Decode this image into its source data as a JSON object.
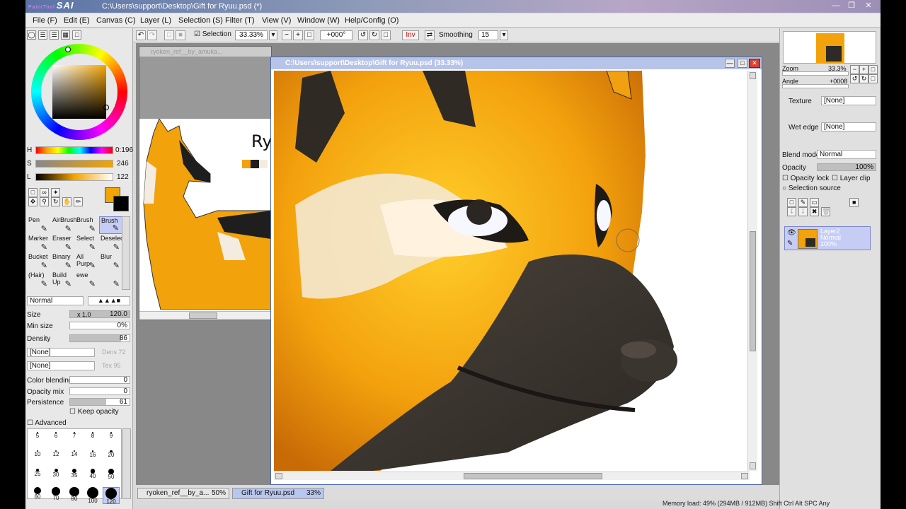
{
  "window": {
    "app_name": "SAI",
    "app_prefix": "PaintTool",
    "title": "C:\\Users\\support\\Desktop\\Gift for Ryuu.psd (*)"
  },
  "menu": [
    "File (F)",
    "Edit (E)",
    "Canvas (C)",
    "Layer (L)",
    "Selection (S)",
    "Filter (T)",
    "View (V)",
    "Window (W)",
    "Help/Config (O)"
  ],
  "toolbar": {
    "selection_label": "Selection",
    "zoom": "33.33%",
    "angle": "+000°",
    "inv": "Inv",
    "smoothing_label": "Smoothing",
    "smoothing_value": "15"
  },
  "color": {
    "h_label": "H",
    "h_value": "0:196",
    "s_label": "S",
    "s_value": "246",
    "l_label": "L",
    "l_value": "122",
    "primary": "#f2a404",
    "secondary": "#000000"
  },
  "tools": [
    [
      "Pen",
      "AirBrush",
      "Brush",
      "Brush"
    ],
    [
      "Marker",
      "Eraser",
      "Select",
      "Deselect"
    ],
    [
      "Bucket",
      "Binary",
      "All Purp",
      "Blur"
    ],
    [
      "(Hair)",
      "Build Up",
      "ewe",
      ""
    ]
  ],
  "brush": {
    "mode": "Normal",
    "size_label": "Size",
    "size_mult": "x 1.0",
    "size_value": "120.0",
    "minsize_label": "Min size",
    "minsize_value": "0%",
    "density_label": "Density",
    "density_value": "86",
    "texture1": "[None]",
    "texture1_hint": "Dens 72",
    "texture2": "[None]",
    "texture2_hint": "Tex 95",
    "color_blending_label": "Color blending",
    "color_blending_value": "0",
    "opacity_mix_label": "Opacity mix",
    "opacity_mix_value": "0",
    "persistence_label": "Persistence",
    "persistence_value": "61",
    "keep_opacity": "Keep opacity",
    "advanced": "Advanced"
  },
  "brush_sizes": [
    "5",
    "6",
    "7",
    "8",
    "9",
    "10",
    "12",
    "14",
    "16",
    "20",
    "25",
    "30",
    "35",
    "40",
    "50",
    "60",
    "70",
    "80",
    "100",
    "120"
  ],
  "doc1": {
    "title": "ryoken_ref__by_amuka...",
    "ref_text": "Ryo"
  },
  "doc2": {
    "title": "C:\\Users\\support\\Desktop\\Gift for Ryuu.psd (33.33%)"
  },
  "tasks": [
    {
      "name": "ryoken_ref__by_a...",
      "zoom": "50%"
    },
    {
      "name": "Gift for Ryuu.psd",
      "zoom": "33%"
    }
  ],
  "navigator": {
    "zoom_label": "Zoom",
    "zoom_value": "33.3%",
    "angle_label": "Angle",
    "angle_value": "+0008"
  },
  "layer_props": {
    "texture_label": "Texture",
    "texture_value": "[None]",
    "wet_edge_label": "Wet edge",
    "wet_edge_value": "[None]",
    "blend_label": "Blend mode",
    "blend_value": "Normal",
    "opacity_label": "Opacity",
    "opacity_value": "100%",
    "opacity_lock": "Opacity lock",
    "layer_clip": "Layer clip",
    "selection_source": "Selection source"
  },
  "layers": [
    {
      "name": "Layer2",
      "mode": "Normal",
      "opacity": "100%"
    }
  ],
  "status": "Memory load: 49% (294MB / 912MB)  Shift Ctrl Alt SPC  Any"
}
